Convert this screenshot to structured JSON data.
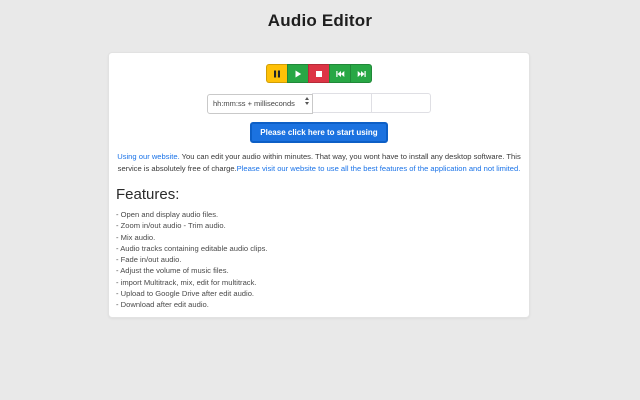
{
  "page": {
    "title": "Audio Editor"
  },
  "theme": {
    "background": "#e9e9e9",
    "card": "#ffffff",
    "primary_blue": "#1b72e0",
    "warning_yellow": "#ffc107",
    "success_green": "#28a745",
    "danger_red": "#dc3545",
    "link_blue": "#1a73e8"
  },
  "player": {
    "buttons": [
      {
        "name": "pause",
        "icon": "pause-icon",
        "color": "#ffc107"
      },
      {
        "name": "play",
        "icon": "play-icon",
        "color": "#28a745"
      },
      {
        "name": "stop",
        "icon": "stop-icon",
        "color": "#dc3545"
      },
      {
        "name": "skip-back",
        "icon": "skip-back-icon",
        "color": "#28a745"
      },
      {
        "name": "skip-forward",
        "icon": "skip-forward-icon",
        "color": "#28a745"
      }
    ]
  },
  "time_controls": {
    "format_select": {
      "selected_value": "hh:mm:ss + milliseconds"
    },
    "time_input_1": {
      "value": "",
      "placeholder": ""
    },
    "time_input_2": {
      "value": "",
      "placeholder": ""
    }
  },
  "start_button": {
    "label": "Please click here to start using"
  },
  "intro": {
    "link_1": "Using our website.",
    "text_1": " You can edit your audio within minutes. That way, you wont have to install any desktop software. This service is absolutely free of charge.",
    "link_2": "Please visit our website to use all the best features of the application and not limited."
  },
  "features": {
    "heading": "Features:",
    "items": [
      "- Open and display audio files.",
      "- Zoom in/out audio - Trim audio.",
      "- Mix audio.",
      "- Audio tracks containing editable audio clips.",
      "- Fade in/out audio.",
      "- Adjust the volume of music files.",
      "- import Multitrack, mix, edit for multitrack.",
      "- Upload to Google Drive after edit audio.",
      "- Download after edit audio."
    ]
  }
}
